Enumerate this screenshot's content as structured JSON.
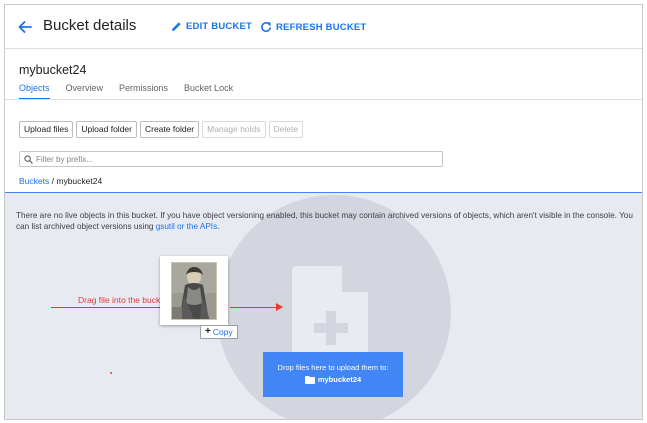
{
  "header": {
    "title": "Bucket details",
    "edit_label": "EDIT BUCKET",
    "refresh_label": "REFRESH BUCKET"
  },
  "bucket": {
    "name": "mybucket24"
  },
  "tabs": [
    {
      "label": "Objects",
      "active": true
    },
    {
      "label": "Overview"
    },
    {
      "label": "Permissions"
    },
    {
      "label": "Bucket Lock"
    }
  ],
  "toolbar": {
    "upload_files": "Upload files",
    "upload_folder": "Upload folder",
    "create_folder": "Create folder",
    "manage_holds": "Manage holds",
    "delete": "Delete"
  },
  "filter": {
    "placeholder": "Filter by prefix..."
  },
  "breadcrumb": {
    "root": "Buckets",
    "separator": "/",
    "current": "mybucket24"
  },
  "dropzone": {
    "info_text": "There are no live objects in this bucket. If you have object versioning enabled, this bucket may contain archived versions of objects, which aren't visible in the console. You can list archived object versions using ",
    "info_link": "gsutil or the APIs",
    "info_end": ".",
    "drag_label": "Drag file into the bucket",
    "copy_label": "Copy",
    "upload_line1": "Drop files here to upload them to:",
    "upload_target": "mybucket24"
  },
  "colors": {
    "accent": "#1a73e8",
    "drag_annotation": "#e53935",
    "drop_zone_bg": "#e8eaf2",
    "upload_box": "#4285f4"
  },
  "icons": {
    "back": "arrow-left-icon",
    "edit": "pencil-icon",
    "refresh": "refresh-icon",
    "search": "search-icon",
    "file_add": "file-add-icon",
    "folder": "folder-icon"
  }
}
